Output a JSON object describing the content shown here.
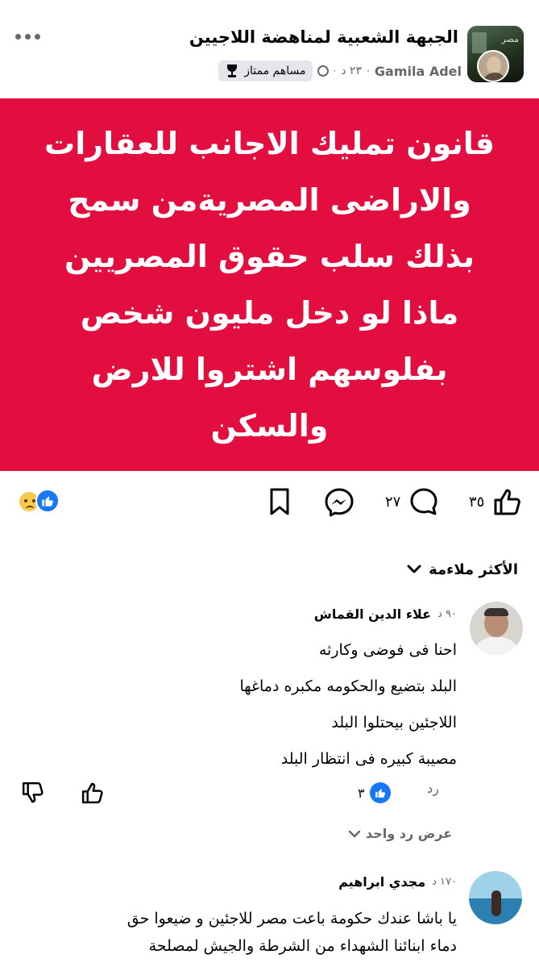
{
  "post": {
    "group_name": "الجبهة الشعبية لمناهضة اللاجيين",
    "author": "Gamila Adel",
    "time": "٢٣ د",
    "separator": "·",
    "badge_label": "مساهم ممتاز",
    "body": "قانون تمليك الاجانب للعقارات\nوالاراضى المصريةمن سمح\nبذلك سلب حقوق المصريين\nماذا لو دخل مليون شخص\nبفلوسهم اشتروا للارض\nوالسكن",
    "card_color": "#e30e40"
  },
  "actions": {
    "like_count": "٣٥",
    "comment_count": "٢٧"
  },
  "comments_section": {
    "sort_label": "الأكثر ملاءمة"
  },
  "comments": [
    {
      "name": "علاء الدين القماش",
      "time": "٩٠ د",
      "text": "احنا  فى  فوضى    وكارثه\nالبلد  بتضيع    والحكومه  مكبره   دماغها\nاللاجئين   بيحتلوا   البلد\nمصيبة  كبيره  فى  انتظار  البلد",
      "reply_label": "رد",
      "reaction_count": "٣",
      "view_replies_label": "عرض رد واحد"
    },
    {
      "name": "مجدي ابراهيم",
      "time": "١٧٠ د",
      "text": "يا باشا عندك حكومة باعت مصر للاجئين و ضيعوا حق\nدماء ابنائنا الشهداء من الشرطة والجيش لمصلحة"
    }
  ],
  "icons": {
    "more": "more-icon",
    "trophy": "trophy-icon",
    "badge": "person-circle-icon",
    "bookmark": "bookmark-icon",
    "messenger": "messenger-icon",
    "comment": "comment-icon",
    "like": "thumbs-up-icon",
    "dislike": "thumbs-down-icon",
    "chevron": "chevron-down-icon"
  },
  "colors": {
    "accent": "#1877f2",
    "text_secondary": "#65676b"
  }
}
